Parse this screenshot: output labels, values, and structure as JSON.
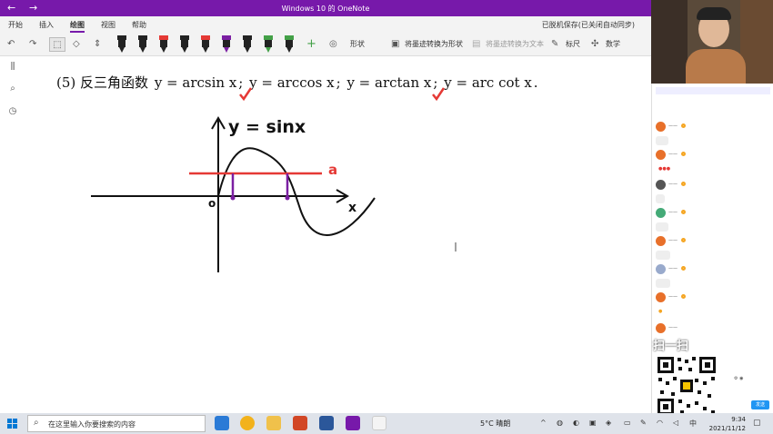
{
  "titlebar": {
    "title": "Windows 10 的 OneNote",
    "back": "←",
    "forward": "→"
  },
  "menu": {
    "tabs": [
      "开始",
      "插入",
      "绘图",
      "视图",
      "帮助"
    ],
    "active_index": 2,
    "status": "已脱机保存(已关闭自动同步)"
  },
  "ribbon": {
    "shapes_label": "形状",
    "ink_to_shape_label": "将墨迹转换为形状",
    "ink_to_text_label": "将墨迹转换为文本",
    "ruler_label": "标尺",
    "math_label": "数学",
    "pen_colors": [
      "#222222",
      "#222222",
      "#e53935",
      "#222222",
      "#e53935",
      "#7b1fa2",
      "#222222",
      "#43a047",
      "#43a047"
    ]
  },
  "note": {
    "formula_prefix": "(5) 反三角函数",
    "formula_parts": [
      "y = arcsin x",
      "y = arccos x",
      "y = arctan x",
      "y = arc cot x"
    ],
    "separator": ";",
    "end": ".",
    "graph_title": "y = sinx",
    "label_a": "a",
    "label_x": "x",
    "label_origin": "o",
    "ink_color": "#111111",
    "accent_color": "#e53935",
    "marker_color": "#7b1fa2"
  },
  "taskbar": {
    "search_placeholder": "在这里输入你要搜索的内容",
    "weather": "5°C 晴朗",
    "time": "9:34",
    "date": "2021/11/12"
  },
  "side": {
    "scan_text": "扫一扫",
    "reply_label": "发送"
  }
}
